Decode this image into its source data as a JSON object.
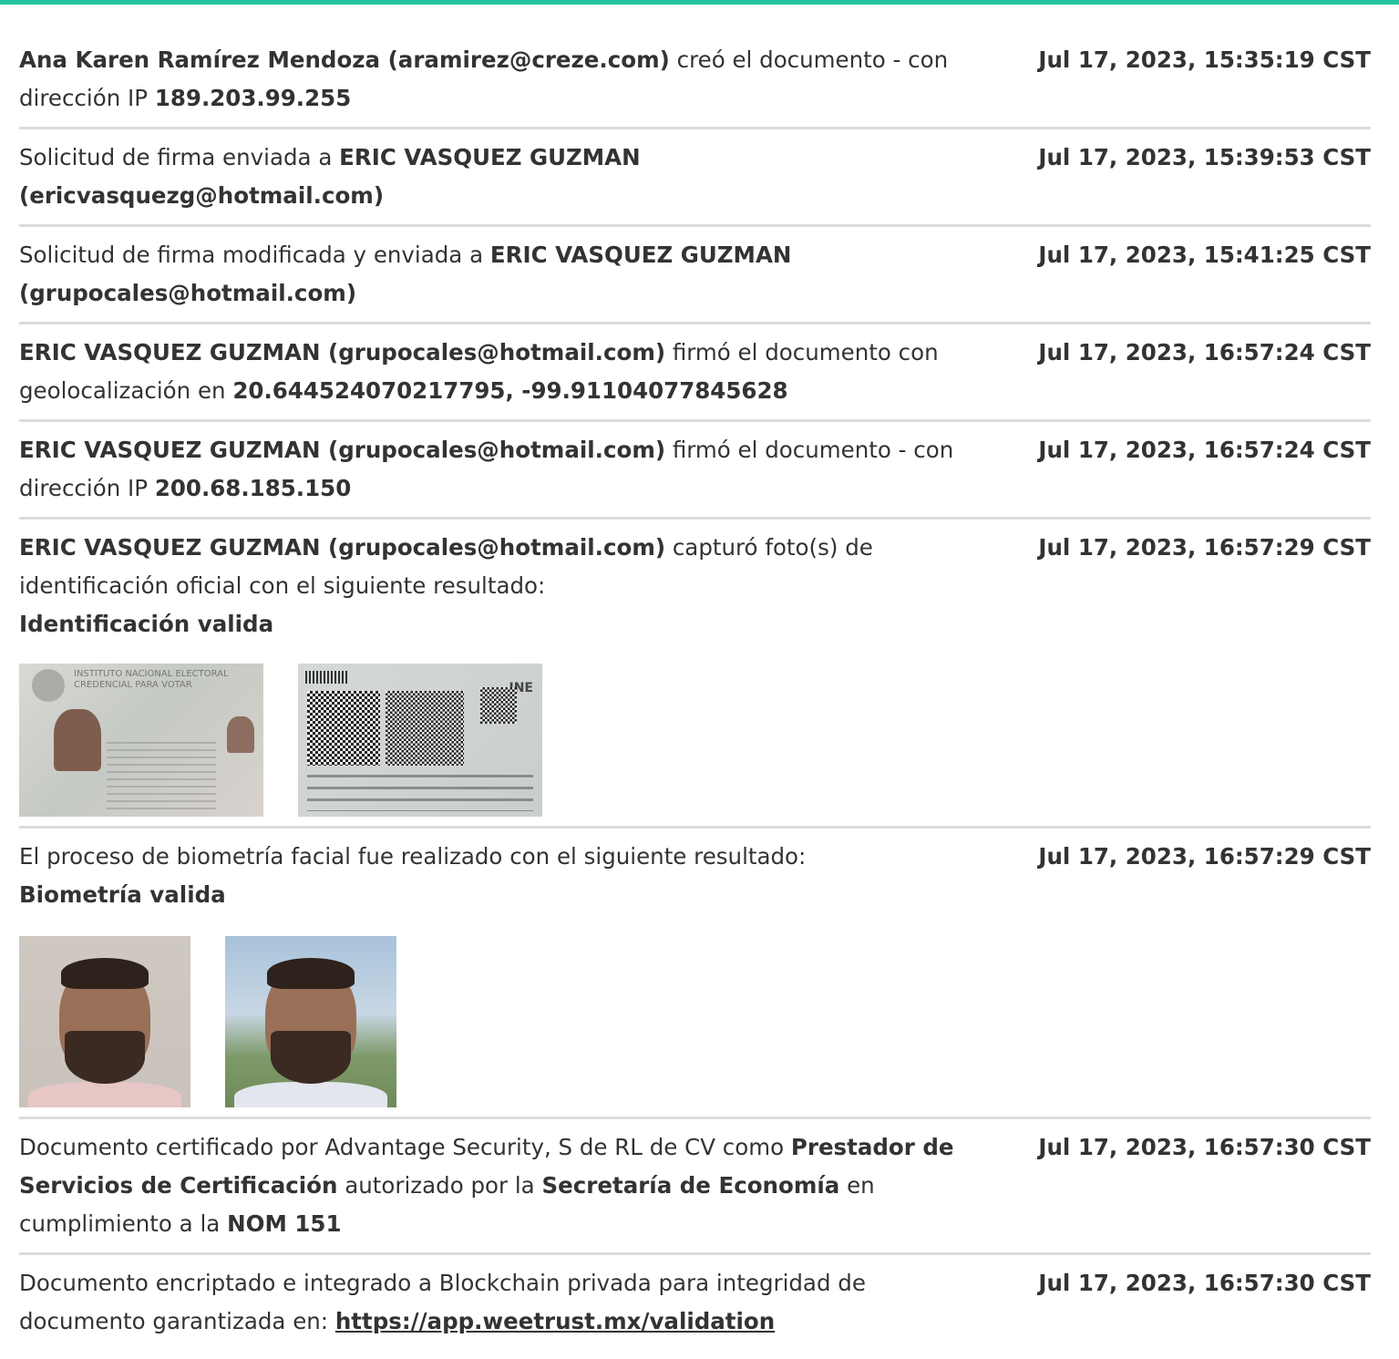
{
  "entries": [
    {
      "segments": [
        {
          "text": "Ana Karen Ramírez Mendoza (aramirez@creze.com)",
          "bold": true
        },
        {
          "text": " creó el documento - con dirección IP ",
          "bold": false
        },
        {
          "text": "189.203.99.255",
          "bold": true
        }
      ],
      "time": "Jul 17, 2023, 15:35:19 CST"
    },
    {
      "segments": [
        {
          "text": "Solicitud de firma enviada a ",
          "bold": false
        },
        {
          "text": "ERIC VASQUEZ GUZMAN (ericvasquezg@hotmail.com)",
          "bold": true
        }
      ],
      "time": "Jul 17, 2023, 15:39:53 CST"
    },
    {
      "segments": [
        {
          "text": "Solicitud de firma modificada y enviada a ",
          "bold": false
        },
        {
          "text": "ERIC VASQUEZ GUZMAN (grupocales@hotmail.com)",
          "bold": true
        }
      ],
      "time": "Jul 17, 2023, 15:41:25 CST"
    },
    {
      "segments": [
        {
          "text": "ERIC VASQUEZ GUZMAN (grupocales@hotmail.com)",
          "bold": true
        },
        {
          "text": " firmó el documento con geolocalización en ",
          "bold": false
        },
        {
          "text": "20.644524070217795, -99.91104077845628",
          "bold": true
        }
      ],
      "time": "Jul 17, 2023, 16:57:24 CST"
    },
    {
      "segments": [
        {
          "text": "ERIC VASQUEZ GUZMAN (grupocales@hotmail.com)",
          "bold": true
        },
        {
          "text": " firmó el documento - con dirección IP ",
          "bold": false
        },
        {
          "text": "200.68.185.150",
          "bold": true
        }
      ],
      "time": "Jul 17, 2023, 16:57:24 CST"
    },
    {
      "segments": [
        {
          "text": "ERIC VASQUEZ GUZMAN (grupocales@hotmail.com)",
          "bold": true
        },
        {
          "text": " capturó foto(s) de identificación oficial con el siguiente resultado:",
          "bold": false
        }
      ],
      "result": "Identificación valida",
      "time": "Jul 17, 2023, 16:57:29 CST"
    },
    {
      "segments": [
        {
          "text": "El proceso de biometría facial fue realizado con el siguiente resultado:",
          "bold": false
        }
      ],
      "result": "Biometría valida",
      "time": "Jul 17, 2023, 16:57:29 CST"
    },
    {
      "segments": [
        {
          "text": "Documento certificado por Advantage Security, S de RL de CV como ",
          "bold": false
        },
        {
          "text": "Prestador de Servicios de Certificación",
          "bold": true
        },
        {
          "text": " autorizado por la ",
          "bold": false
        },
        {
          "text": "Secretaría de Economía",
          "bold": true
        },
        {
          "text": " en cumplimiento a la ",
          "bold": false
        },
        {
          "text": "NOM 151",
          "bold": true
        }
      ],
      "time": "Jul 17, 2023, 16:57:30 CST"
    },
    {
      "segments": [
        {
          "text": "Documento encriptado e integrado a Blockchain privada para integridad de documento garantizada en: ",
          "bold": false
        }
      ],
      "link": "https://app.weetrust.mx/validation",
      "time": "Jul 17, 2023, 16:57:30 CST"
    }
  ],
  "id_card": {
    "header_line1": "INSTITUTO NACIONAL ELECTORAL",
    "header_line2": "CREDENCIAL PARA VOTAR",
    "back_logo": "INE"
  },
  "colors": {
    "accent_bar": "#22c4a0",
    "divider": "#dcdcdc",
    "text": "#333333"
  }
}
